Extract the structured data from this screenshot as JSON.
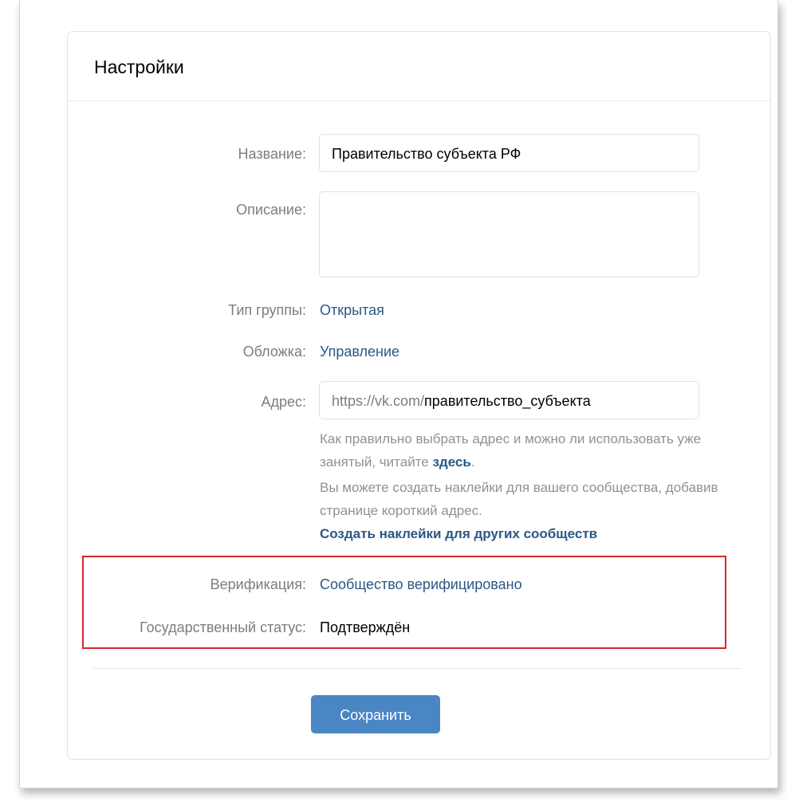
{
  "settings": {
    "title": "Настройки",
    "name_label": "Название:",
    "name_value": "Правительство субъекта РФ",
    "description_label": "Описание:",
    "description_value": "",
    "group_type_label": "Тип группы:",
    "group_type_value": "Открытая",
    "cover_label": "Обложка:",
    "cover_value": "Управление",
    "address_label": "Адрес:",
    "address_prefix": "https://vk.com/",
    "address_value": "правительство_субъекта",
    "hint1_text": "Как правильно выбрать адрес и можно ли использовать уже занятый, читайте ",
    "hint1_link": "здесь",
    "hint1_end": ".",
    "hint2_text": "Вы можете создать наклейки для вашего сообщества, добавив странице короткий адрес.",
    "hint2_link": "Создать наклейки для других сообществ",
    "verification_label": "Верификация:",
    "verification_value": "Сообщество верифицировано",
    "gov_status_label": "Государственный статус:",
    "gov_status_value": "Подтверждён",
    "save_label": "Сохранить"
  },
  "colors": {
    "link": "#2a5885",
    "label": "#7a7d82",
    "button": "#4a86c4",
    "highlight_border": "#d9252c"
  }
}
